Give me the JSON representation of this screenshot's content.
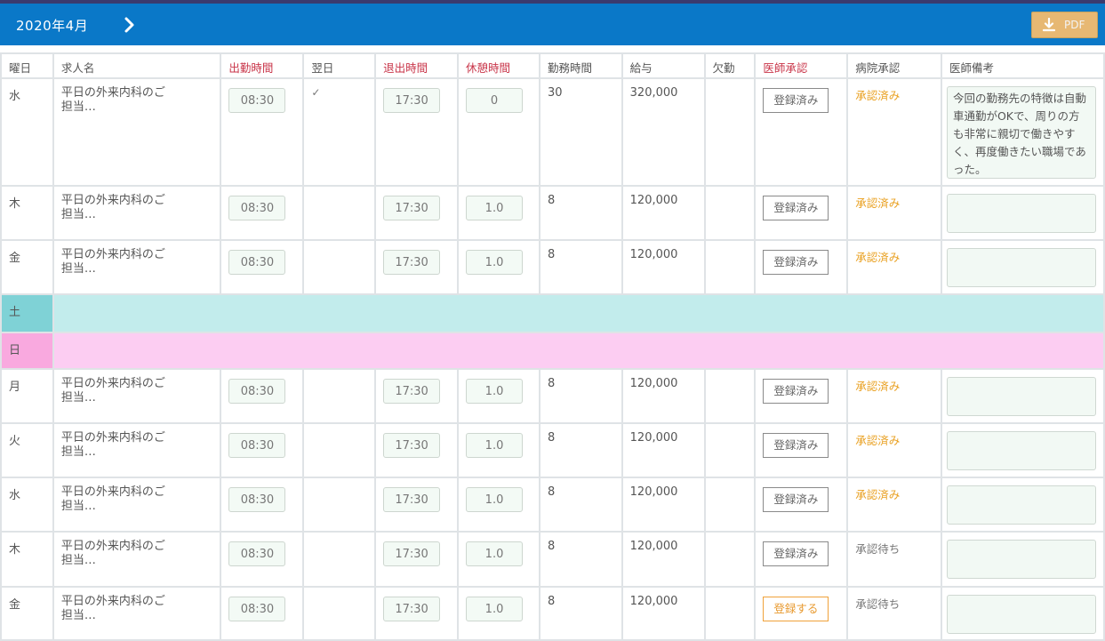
{
  "header": {
    "month": "2020年4月",
    "pdf_label": "PDF"
  },
  "columns": [
    "曜日",
    "求人名",
    "出勤時間",
    "翌日",
    "退出時間",
    "休憩時間",
    "勤務時間",
    "給与",
    "欠勤",
    "医師承認",
    "病院承認",
    "医師備考"
  ],
  "rows": [
    {
      "day": "水",
      "job": "平日の外来内科のご担当…",
      "start": "08:30",
      "nextday": "✓",
      "end": "17:30",
      "break": "0",
      "hours": "30",
      "salary": "320,000",
      "absent": "",
      "doctor": "登録済み",
      "hospital": "承認済み",
      "memo": "今回の勤務先の特徴は自動車通勤がOKで、周りの方も非常に親切で働きやすく、再度働きたい職場であった。"
    },
    {
      "day": "木",
      "job": "平日の外来内科のご担当…",
      "start": "08:30",
      "nextday": "",
      "end": "17:30",
      "break": "1.0",
      "hours": "8",
      "salary": "120,000",
      "absent": "",
      "doctor": "登録済み",
      "hospital": "承認済み",
      "memo": ""
    },
    {
      "day": "金",
      "job": "平日の外来内科のご担当…",
      "start": "08:30",
      "nextday": "",
      "end": "17:30",
      "break": "1.0",
      "hours": "8",
      "salary": "120,000",
      "absent": "",
      "doctor": "登録済み",
      "hospital": "承認済み",
      "memo": ""
    },
    {
      "day": "土"
    },
    {
      "day": "日"
    },
    {
      "day": "月",
      "job": "平日の外来内科のご担当…",
      "start": "08:30",
      "nextday": "",
      "end": "17:30",
      "break": "1.0",
      "hours": "8",
      "salary": "120,000",
      "absent": "",
      "doctor": "登録済み",
      "hospital": "承認済み",
      "memo": ""
    },
    {
      "day": "火",
      "job": "平日の外来内科のご担当…",
      "start": "08:30",
      "nextday": "",
      "end": "17:30",
      "break": "1.0",
      "hours": "8",
      "salary": "120,000",
      "absent": "",
      "doctor": "登録済み",
      "hospital": "承認済み",
      "memo": ""
    },
    {
      "day": "水",
      "job": "平日の外来内科のご担当…",
      "start": "08:30",
      "nextday": "",
      "end": "17:30",
      "break": "1.0",
      "hours": "8",
      "salary": "120,000",
      "absent": "",
      "doctor": "登録済み",
      "hospital": "承認済み",
      "memo": ""
    },
    {
      "day": "木",
      "job": "平日の外来内科のご担当…",
      "start": "08:30",
      "nextday": "",
      "end": "17:30",
      "break": "1.0",
      "hours": "8",
      "salary": "120,000",
      "absent": "",
      "doctor": "登録済み",
      "hospital": "承認待ち",
      "memo": ""
    },
    {
      "day": "金",
      "job": "平日の外来内科のご担当…",
      "start": "08:30",
      "nextday": "",
      "end": "17:30",
      "break": "1.0",
      "hours": "8",
      "salary": "120,000",
      "absent": "",
      "doctor": "登録する",
      "hospital": "承認待ち",
      "memo": ""
    }
  ],
  "colors": {
    "header_bg": "#0a78c8",
    "required_label": "#c9364a",
    "approved": "#e9a020",
    "saturday": "#c2ecec",
    "sunday": "#fccdf2",
    "pdf_button": "#e7b873"
  },
  "icons": {
    "next": "chevron-right-icon",
    "pdf": "download-icon"
  }
}
